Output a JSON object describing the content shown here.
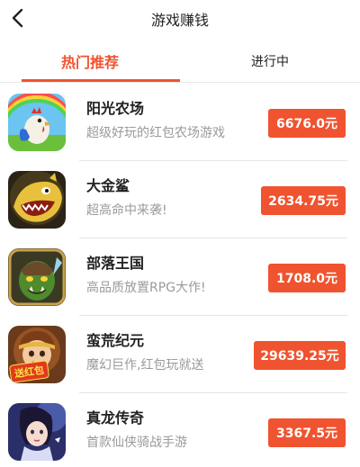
{
  "header": {
    "title": "游戏赚钱",
    "back_icon": "chevron-left-icon"
  },
  "tabs": [
    {
      "label": "热门推荐",
      "active": true
    },
    {
      "label": "进行中",
      "active": false
    }
  ],
  "accent_color": "#f0532f",
  "games": [
    {
      "name": "阳光农场",
      "desc": "超级好玩的红包农场游戏",
      "reward": "6676.0元",
      "icon": "rooster-farm-icon"
    },
    {
      "name": "大金鲨",
      "desc": "超高命中来袭!",
      "reward": "2634.75元",
      "icon": "golden-shark-icon"
    },
    {
      "name": "部落王国",
      "desc": "高品质放置RPG大作!",
      "reward": "1708.0元",
      "icon": "orc-warrior-icon"
    },
    {
      "name": "蛮荒纪元",
      "desc": "魔幻巨作,红包玩就送",
      "reward": "29639.25元",
      "icon": "warrior-hero-icon",
      "badge": "送红包"
    },
    {
      "name": "真龙传奇",
      "desc": "首款仙侠骑战手游",
      "reward": "3367.5元",
      "icon": "fairy-swordsman-icon"
    }
  ]
}
